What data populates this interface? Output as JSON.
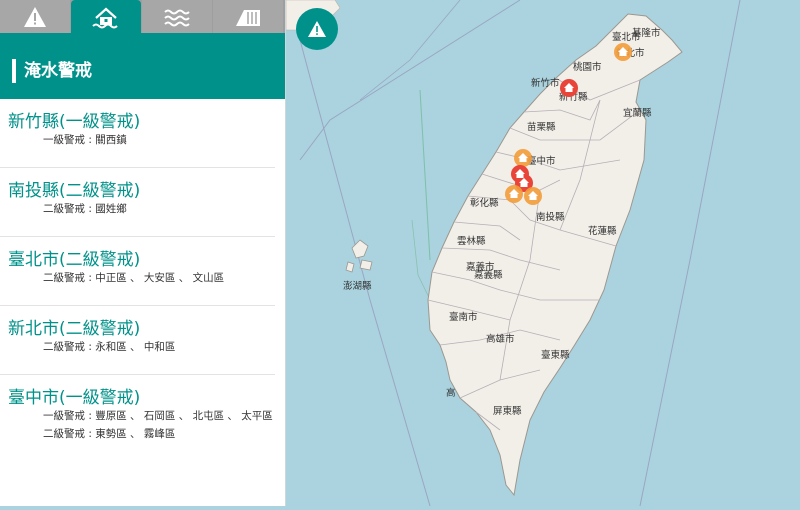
{
  "tabs": [
    {
      "icon": "warning-icon",
      "active": false
    },
    {
      "icon": "flood-house-icon",
      "active": true
    },
    {
      "icon": "waves-icon",
      "active": false
    },
    {
      "icon": "dam-icon",
      "active": false
    }
  ],
  "panel": {
    "title": "淹水警戒"
  },
  "alerts": [
    {
      "region": "新竹縣(一級警戒)",
      "lines": [
        "一級警戒 : 關西鎮"
      ]
    },
    {
      "region": "南投縣(二級警戒)",
      "lines": [
        "二級警戒 : 國姓鄉"
      ]
    },
    {
      "region": "臺北市(二級警戒)",
      "lines": [
        "二級警戒 : 中正區 、 大安區 、 文山區"
      ]
    },
    {
      "region": "新北市(二級警戒)",
      "lines": [
        "二級警戒 : 永和區 、 中和區"
      ]
    },
    {
      "region": "臺中市(一級警戒)",
      "lines": [
        "一級警戒 : 豐原區 、 石岡區 、 北屯區 、 太平區",
        "二級警戒 : 東勢區 、 霧峰區"
      ]
    }
  ],
  "map": {
    "labels": [
      "基隆市",
      "臺北市",
      "新北市",
      "桃園市",
      "新竹市",
      "新竹縣",
      "宜蘭縣",
      "苗栗縣",
      "臺中市",
      "彰化縣",
      "南投縣",
      "花蓮縣",
      "雲林縣",
      "嘉義縣",
      "嘉義市",
      "澎湖縣",
      "臺南市",
      "高雄市",
      "臺東縣",
      "屏東縣",
      "高"
    ],
    "markers": [
      {
        "level": "二級",
        "color": "#f39c3a"
      },
      {
        "level": "一級",
        "color": "#e8443a"
      },
      {
        "level": "二級",
        "color": "#f39c3a"
      },
      {
        "level": "一級",
        "color": "#e8443a"
      },
      {
        "level": "一級",
        "color": "#e8443a"
      },
      {
        "level": "二級",
        "color": "#f39c3a"
      },
      {
        "level": "二級",
        "color": "#f39c3a"
      }
    ],
    "colors": {
      "sea": "#aad3df",
      "land": "#f2efe9",
      "accent": "#00928a"
    }
  }
}
